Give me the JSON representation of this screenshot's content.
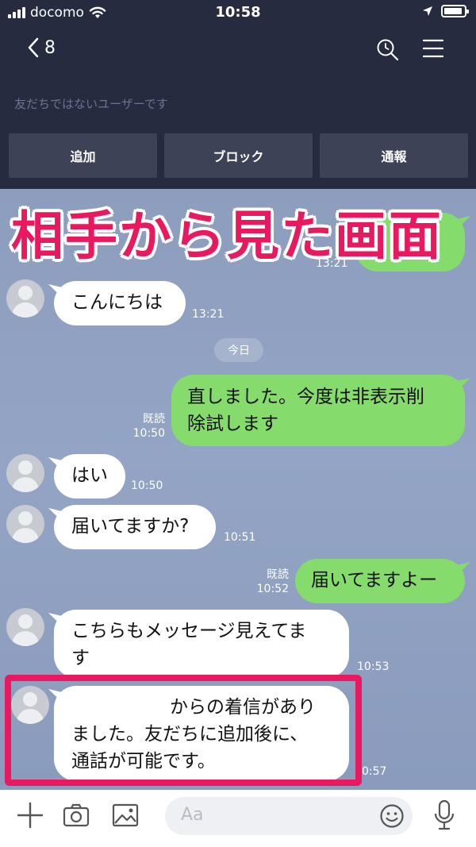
{
  "status_bar": {
    "carrier": "docomo",
    "time": "10:58"
  },
  "header": {
    "back_count": "8",
    "notice": "友だちではないユーザーです",
    "actions": [
      "追加",
      "ブロック",
      "通報"
    ]
  },
  "overlay": {
    "title": "相手から見た画面"
  },
  "chat": {
    "date_label": "今日",
    "messages": [
      {
        "direction": "in",
        "text": "こんにちは",
        "time": "13:21"
      },
      {
        "direction": "out",
        "line1": "直しました。今度は非表示削",
        "line2": "除試します",
        "read": "既読",
        "time": "10:50"
      },
      {
        "direction": "in",
        "text": "はい",
        "time": "10:50"
      },
      {
        "direction": "in",
        "text": "届いてますか?",
        "time": "10:51"
      },
      {
        "direction": "out",
        "text": "届いてますよー",
        "read": "既読",
        "time": "10:52"
      },
      {
        "direction": "in",
        "line1": "こちらもメッセージ見えてま",
        "line2": "す",
        "time": "10:53"
      },
      {
        "direction": "in",
        "line1": "からの着信があり",
        "line2": "ました。友だちに追加後に、",
        "line3": "通話が可能です。",
        "time": "0:57"
      }
    ],
    "partial_times": [
      "13:21"
    ]
  },
  "input_bar": {
    "placeholder": "Aa"
  },
  "icons": {
    "signal": "signal-bars-icon",
    "wifi": "wifi-icon",
    "location": "location-arrow-icon",
    "battery": "battery-icon",
    "back": "chevron-left-icon",
    "search": "search-icon",
    "menu": "menu-icon",
    "add": "plus-icon",
    "camera": "camera-icon",
    "image": "image-icon",
    "emoji": "emoji-icon",
    "mic": "microphone-icon"
  },
  "colors": {
    "header_bg": "#262b40",
    "chat_bg": "#8f9fbe",
    "out_bubble": "#85dc6c",
    "in_bubble": "#ffffff",
    "highlight": "#e8195e"
  }
}
